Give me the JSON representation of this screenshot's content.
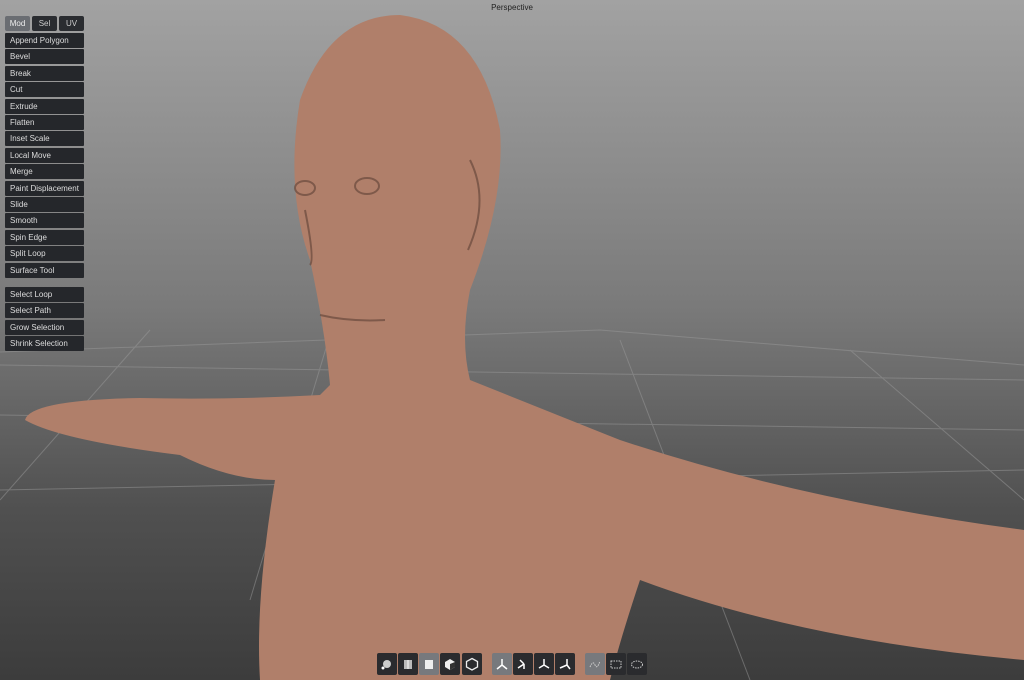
{
  "viewport": {
    "title": "Perspective",
    "mesh_color": "#b07f6a"
  },
  "tabs": [
    {
      "label": "Mod",
      "active": true
    },
    {
      "label": "Sel",
      "active": false
    },
    {
      "label": "UV",
      "active": false
    }
  ],
  "tools": [
    "Append Polygon",
    "Bevel",
    "Break",
    "Cut",
    "Extrude",
    "Flatten",
    "Inset Scale",
    "Local Move",
    "Merge",
    "Paint Displacement",
    "Slide",
    "Smooth",
    "Spin Edge",
    "Split Loop",
    "Surface Tool"
  ],
  "selection_tools": [
    "Select Loop",
    "Select Path",
    "Grow Selection",
    "Shrink Selection"
  ],
  "toolbar": {
    "icons": [
      "vertex-mode-icon",
      "edge-mode-icon",
      "face-mode-icon",
      "object-mode-icon",
      "hull-mode-icon",
      "world-axis-icon",
      "local-axis-icon",
      "normal-axis-icon",
      "screen-axis-icon",
      "lasso-select-icon",
      "rect-select-icon",
      "ellipse-select-icon"
    ],
    "active": [
      "face-mode-icon",
      "world-axis-icon",
      "lasso-select-icon"
    ]
  }
}
